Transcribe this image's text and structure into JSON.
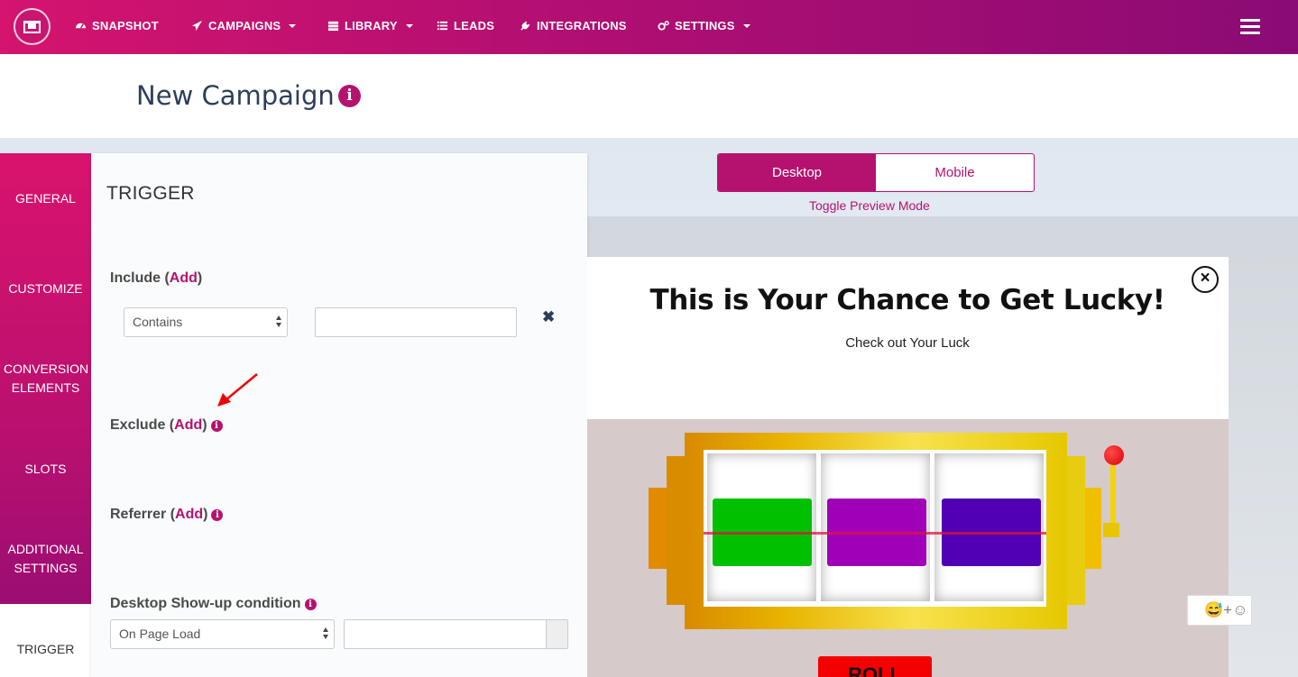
{
  "nav": {
    "items": [
      {
        "label": "SNAPSHOT",
        "icon": "dashboard-icon"
      },
      {
        "label": "CAMPAIGNS",
        "icon": "paper-plane-icon",
        "dropdown": true
      },
      {
        "label": "LIBRARY",
        "icon": "server-icon",
        "dropdown": true
      },
      {
        "label": "LEADS",
        "icon": "list-icon"
      },
      {
        "label": "INTEGRATIONS",
        "icon": "plug-icon"
      },
      {
        "label": "SETTINGS",
        "icon": "gears-icon",
        "dropdown": true
      }
    ],
    "menu_icon": "hamburger-icon"
  },
  "header": {
    "title": "New Campaign",
    "info_icon": "i"
  },
  "sidebar": {
    "items": [
      {
        "label": "GENERAL"
      },
      {
        "label": "CUSTOMIZE"
      },
      {
        "label": "CONVERSION ELEMENTS"
      },
      {
        "label": "SLOTS"
      },
      {
        "label": "ADDITIONAL SETTINGS"
      },
      {
        "label": "TRIGGER",
        "active": true
      }
    ]
  },
  "trigger": {
    "title": "TRIGGER",
    "include": {
      "label": "Include",
      "add": "Add",
      "select_value": "Contains",
      "input_value": "",
      "remove": "✖"
    },
    "exclude": {
      "label": "Exclude",
      "add": "Add"
    },
    "referrer": {
      "label": "Referrer",
      "add": "Add"
    },
    "desktop_condition": {
      "label": "Desktop Show-up condition",
      "select_value": "On Page Load",
      "input_value": ""
    }
  },
  "preview": {
    "desktop_label": "Desktop",
    "mobile_label": "Mobile",
    "active": "Desktop",
    "hint": "Toggle Preview Mode"
  },
  "popup": {
    "title": "This is Your Chance to Get Lucky!",
    "subtitle": "Check out Your Luck",
    "close": "×",
    "reels": [
      {
        "color": "#00c000"
      },
      {
        "color": "#a000b8"
      },
      {
        "color": "#5200b4"
      }
    ],
    "roll_label": "ROLL",
    "emoji_icons": "😅+☺"
  },
  "colors": {
    "brand": "#b5126f",
    "nav_gradient_start": "#d4146e",
    "nav_gradient_end": "#8a0b74",
    "annotation_arrow": "#f00000"
  }
}
